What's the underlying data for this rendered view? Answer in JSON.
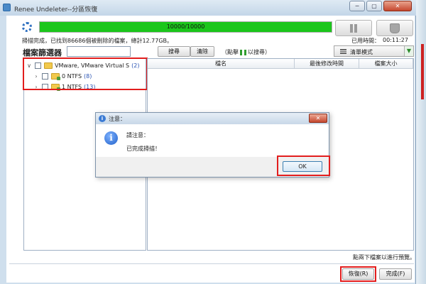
{
  "window": {
    "title": "Renee Undeleter--分區恢復",
    "min_glyph": "─",
    "max_glyph": "▢",
    "close_glyph": "✕"
  },
  "scan": {
    "progress_text": "10000/10000",
    "progress_fraction": 1.0,
    "status": "掃描完成，已找到86686個被刪除的檔案，總計12.77GB。",
    "elapsed_label": "已用時間：",
    "elapsed_value": "00:11:27"
  },
  "filter": {
    "label": "檔案篩選器",
    "input_value": "",
    "search_button": "搜尋",
    "clear_button": "清除",
    "hint_before": "（點擊",
    "hint_after": "以搜尋）"
  },
  "view": {
    "mode_label": "清單模式"
  },
  "tree": [
    {
      "label": "VMware, VMware Virtual S",
      "count": "(2)",
      "expanded": true,
      "level": 0
    },
    {
      "label": "0 NTFS",
      "count": "(8)",
      "expanded": false,
      "level": 1
    },
    {
      "label": "1 NTFS",
      "count": "(13)",
      "expanded": false,
      "level": 1
    }
  ],
  "file_columns": [
    "檔名",
    "最後修改時間",
    "檔案大小"
  ],
  "preview_hint": "點兩下檔案以進行預覽。",
  "footer": {
    "recover_button": "恢復(R)",
    "finish_button": "完成(F)"
  },
  "dialog": {
    "title": "注意：",
    "close_glyph": "✕",
    "line1": "請注意：",
    "line2": "已完成掃描！",
    "ok_button": "OK",
    "icon_glyph": "i"
  },
  "icons": {
    "spinner": "loading-spinner-icon",
    "pause": "pause-icon",
    "stop": "stop-icon",
    "list": "list-view-icon",
    "dropdown": "chevron-down-icon",
    "info": "info-icon",
    "folder": "folder-icon",
    "disk": "disk-partition-icon"
  },
  "colors": {
    "progress_fill": "#1bc61b",
    "highlight": "#e21d1d",
    "count_text": "#2a54b4"
  }
}
